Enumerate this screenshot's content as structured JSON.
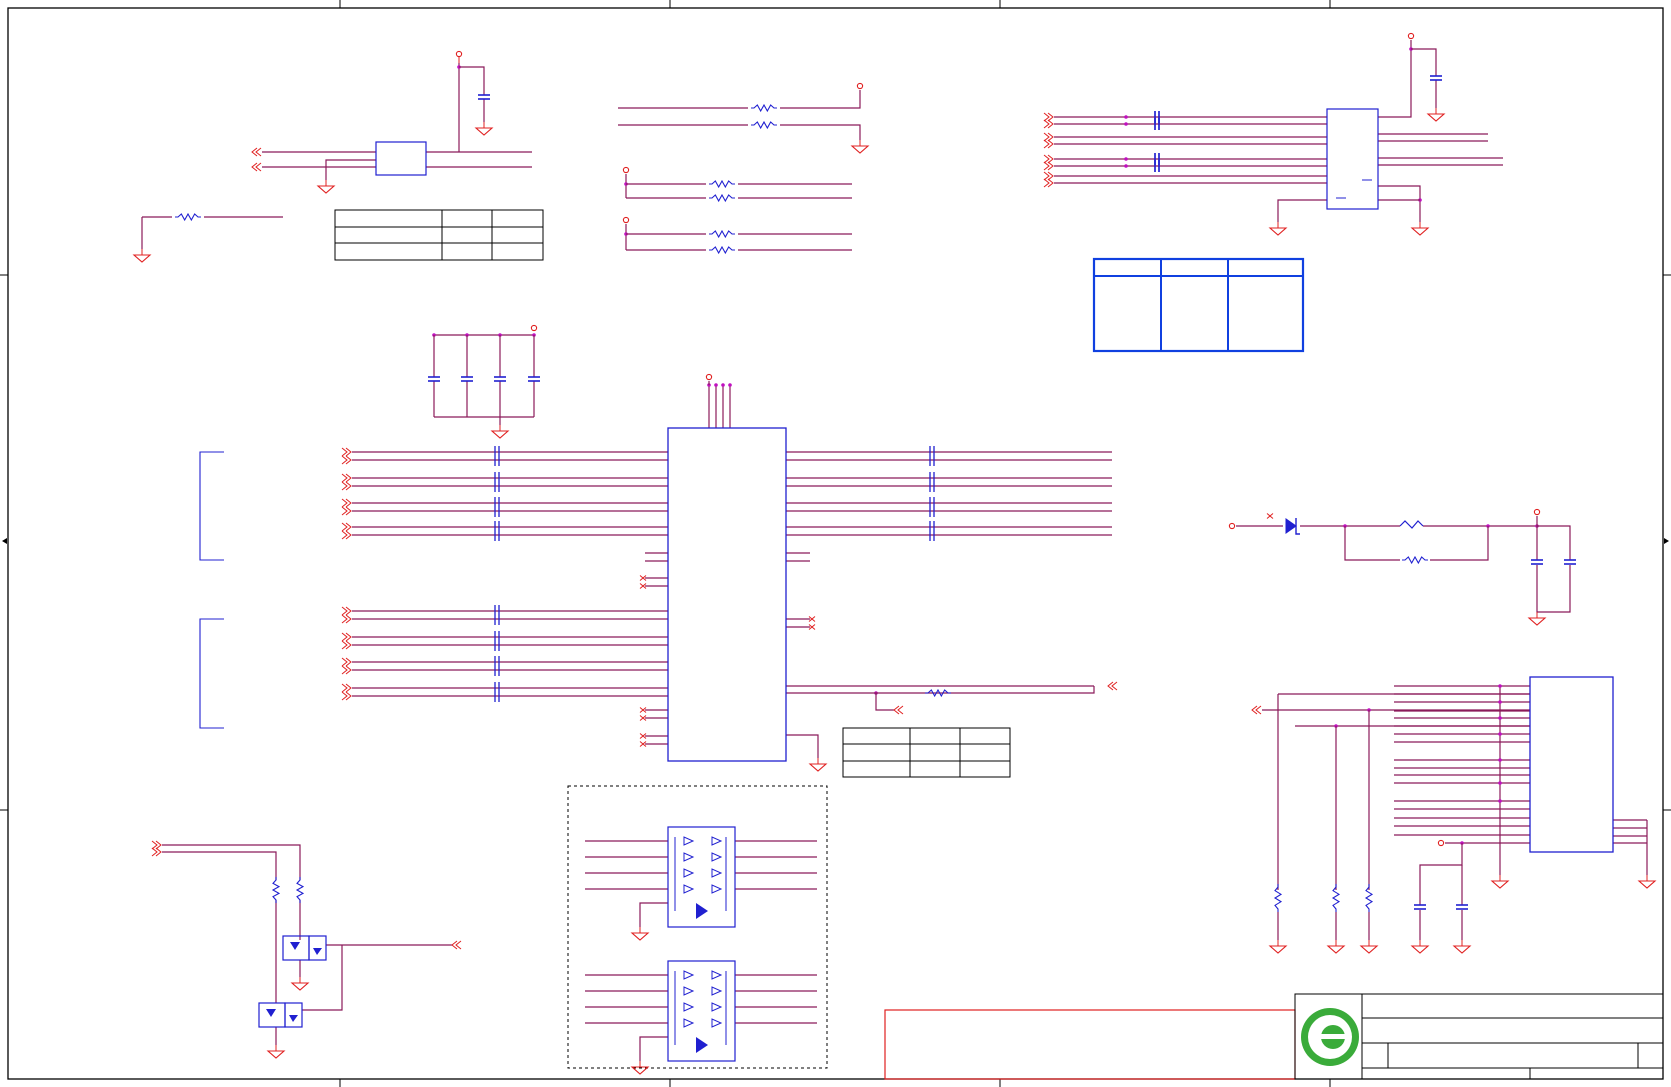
{
  "title": "",
  "colors": {
    "wire": "#8b1a5a",
    "wire_red": "#e02020",
    "component": "#2020d0",
    "junction": "#c010c0",
    "frame": "#000000",
    "title_block": "#1040e0",
    "logo": "#3aab3a"
  },
  "logo": {
    "icon": "company-logo-icon",
    "letter": "e"
  },
  "tables": {
    "count": 4
  }
}
